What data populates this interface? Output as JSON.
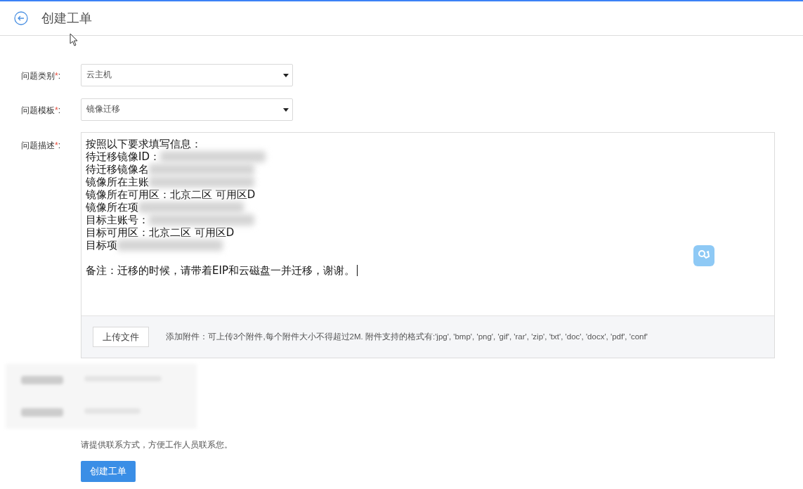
{
  "header": {
    "title": "创建工单"
  },
  "fields": [
    {
      "label": "问题类别",
      "required_mark": "*",
      "colon": ":",
      "value": "云主机"
    },
    {
      "label": "问题模板",
      "required_mark": "*",
      "colon": ":",
      "value": "镜像迁移"
    }
  ],
  "description": {
    "label": "问题描述",
    "required_mark": "*",
    "colon": ":",
    "lines": [
      {
        "text": "按照以下要求填写信息：",
        "redacted": false
      },
      {
        "text": "待迁移镜像ID：",
        "redacted": true
      },
      {
        "text": "待迁移镜像名",
        "redacted": true
      },
      {
        "text": "镜像所在主账",
        "redacted": true
      },
      {
        "text": "镜像所在可用区：北京二区 可用区D",
        "redacted": false
      },
      {
        "text": "镜像所在项",
        "redacted": true
      },
      {
        "text": "目标主账号：",
        "redacted": true
      },
      {
        "text": "目标可用区：北京二区 可用区D",
        "redacted": false
      },
      {
        "text": "目标项",
        "redacted": true
      }
    ],
    "note": "备注：迁移的时候，请带着EIP和云磁盘一并迁移，谢谢。"
  },
  "upload": {
    "button": "上传文件",
    "hint": "添加附件：可上传3个附件,每个附件大小不得超过2M. 附件支持的格式有:'jpg', 'bmp', 'png', 'gif', 'rar', 'zip', 'txt', 'doc', 'docx', 'pdf', 'conf'"
  },
  "contact_hint": "请提供联系方式，方便工作人员联系您。",
  "submit": "创建工单"
}
